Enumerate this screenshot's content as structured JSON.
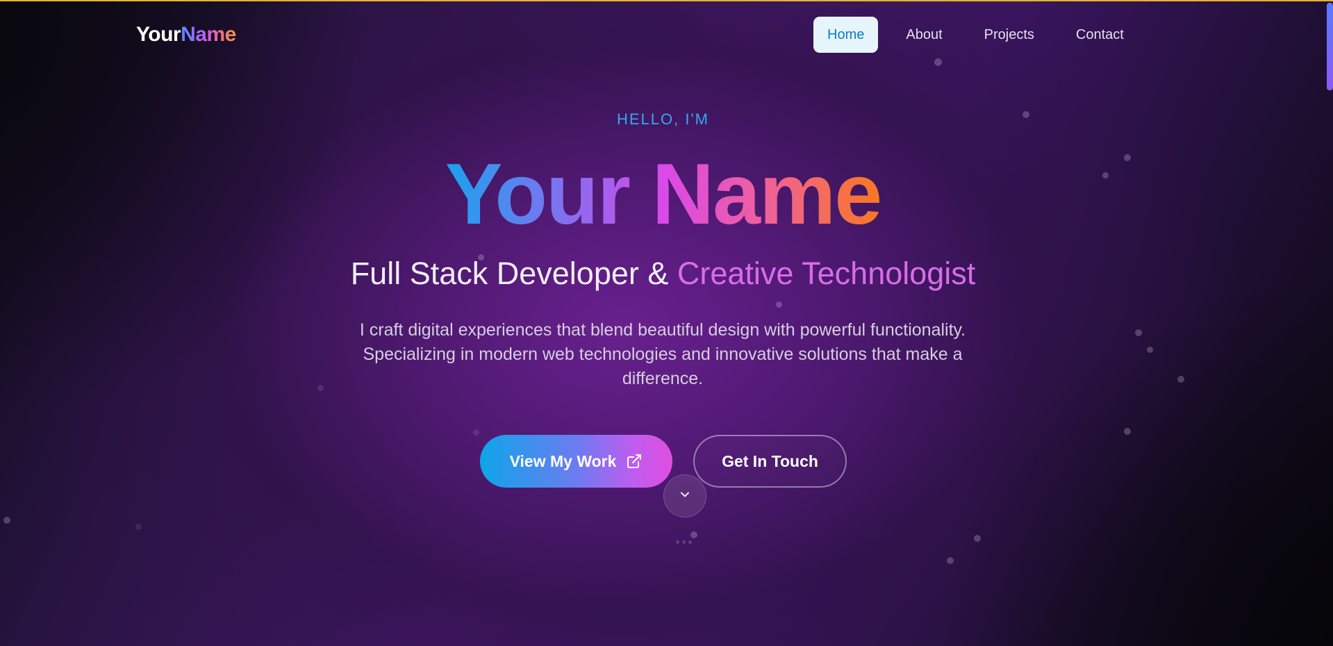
{
  "nav": {
    "logo_part1": "Your",
    "logo_part2": "Name",
    "links": [
      {
        "label": "Home",
        "active": true
      },
      {
        "label": "About",
        "active": false
      },
      {
        "label": "Projects",
        "active": false
      },
      {
        "label": "Contact",
        "active": false
      }
    ]
  },
  "hero": {
    "eyebrow": "HELLO, I'M",
    "name": "Your Name",
    "subtitle_main": "Full Stack Developer & ",
    "subtitle_accent": "Creative Technologist",
    "description": "I craft digital experiences that blend beautiful design with powerful functionality. Specializing in modern web technologies and innovative solutions that make a difference.",
    "primary_button": "View My Work",
    "primary_button_icon": "external-link-icon",
    "secondary_button": "Get In Touch",
    "scroll_icon": "chevron-down-icon"
  },
  "colors": {
    "accent_blue": "#36a8f0",
    "accent_purple": "#d86de8",
    "active_nav_bg": "#e6f4fc",
    "active_nav_text": "#0b7cc6"
  }
}
